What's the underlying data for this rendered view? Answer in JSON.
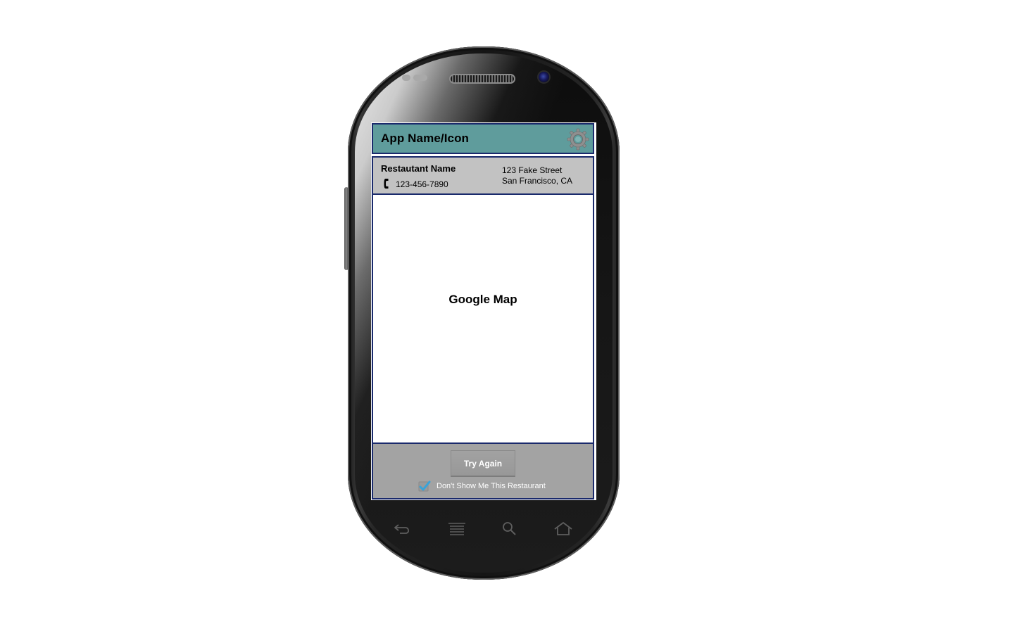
{
  "app": {
    "title": "App Name/Icon",
    "settings_icon": "gear-icon"
  },
  "restaurant": {
    "name": "Restautant Name",
    "phone": "123-456-7890",
    "phone_icon": "phone-icon",
    "address_line1": "123 Fake Street",
    "address_line2": "San Francisco, CA"
  },
  "map": {
    "label": "Google Map"
  },
  "footer": {
    "try_again_label": "Try Again",
    "dont_show_label": "Don't Show Me This Restaurant",
    "dont_show_checked": true
  },
  "navigation": {
    "keys": [
      "back-icon",
      "menu-icon",
      "search-icon",
      "home-icon"
    ]
  },
  "colors": {
    "appbar": "#5f9c9c",
    "info_bar": "#c2c2c2",
    "footer": "#a3a3a3",
    "border": "#1a2a6c",
    "check": "#3aa3d8"
  }
}
